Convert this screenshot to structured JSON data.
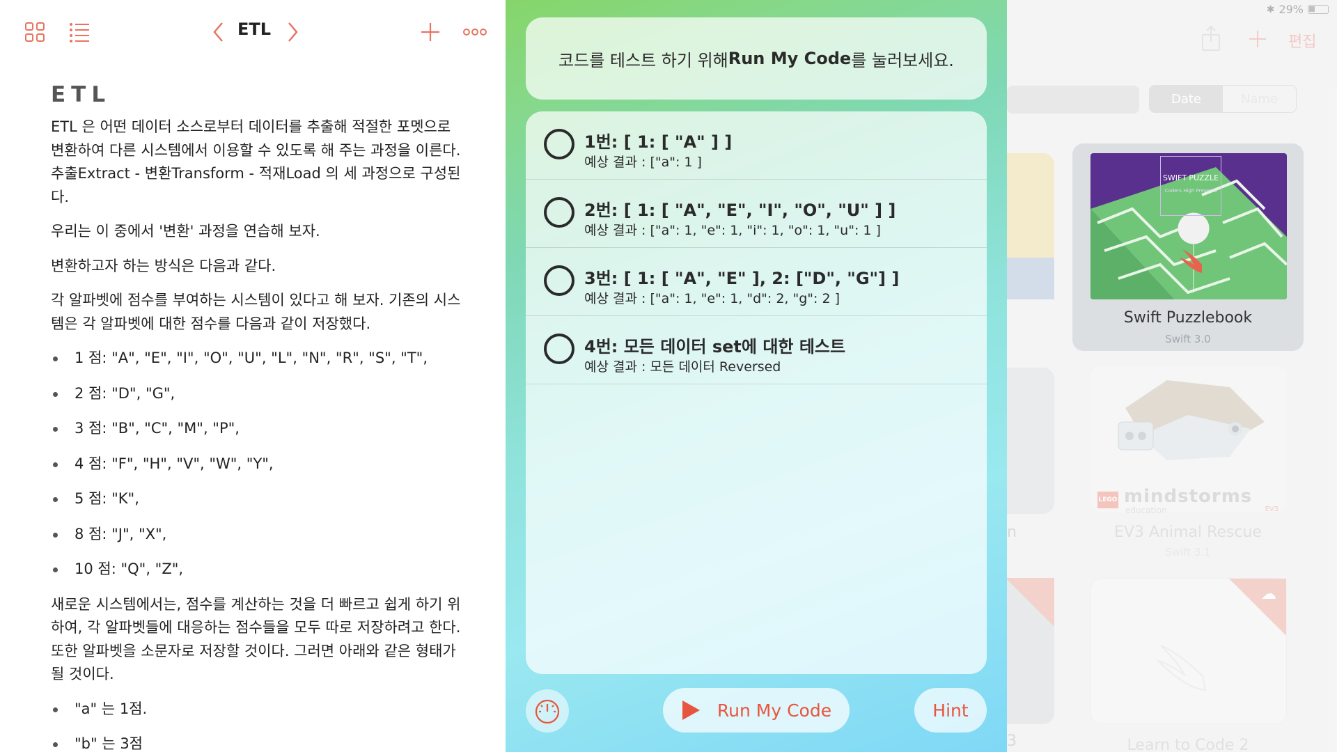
{
  "doc_nav": {
    "title": "ETL"
  },
  "document": {
    "heading": "ETL",
    "paragraphs_top": [
      "ETL 은 어떤 데이터 소스로부터 데이터를 추출해 적절한 포멧으로 변환하여 다른 시스템에서 이용할 수 있도록 해 주는 과정을 이른다. 추출Extract - 변환Transform - 적재Load 의 세 과정으로 구성된다.",
      "우리는 이 중에서 '변환' 과정을 연습해 보자.",
      "변환하고자 하는 방식은 다음과 같다.",
      "각 알파벳에 점수를 부여하는 시스템이 있다고 해 보자. 기존의 시스템은 각 알파벳에 대한 점수를 다음과 같이 저장했다."
    ],
    "score_list": [
      "1 점: \"A\", \"E\", \"I\", \"O\", \"U\", \"L\", \"N\", \"R\", \"S\", \"T\",",
      "2 점: \"D\", \"G\",",
      "3 점: \"B\", \"C\", \"M\", \"P\",",
      "4 점: \"F\", \"H\", \"V\", \"W\", \"Y\",",
      "5 점: \"K\",",
      "8 점: \"J\", \"X\",",
      "10 점: \"Q\", \"Z\","
    ],
    "paragraph_bottom": "새로운 시스템에서는, 점수를 계산하는 것을 더 빠르고 쉽게 하기 위하여, 각 알파벳들에 대응하는 점수들을 모두 따로 저장하려고 한다. 또한 알파벳을 소문자로 저장할 것이다. 그러면 아래와 같은 형태가 될 것이다.",
    "letter_list": [
      "\"a\" 는 1점.",
      "\"b\" 는 3점"
    ]
  },
  "live_view": {
    "banner_prefix": "코드를 테스트 하기 위해 ",
    "banner_bold": "Run My Code",
    "banner_suffix": "를 눌러보세요.",
    "tests": [
      {
        "title": "1번: [ 1: [ \"A\" ] ]",
        "expected": "예상 결과 : [\"a\": 1 ]"
      },
      {
        "title": "2번: [ 1: [ \"A\", \"E\", \"I\", \"O\", \"U\" ] ]",
        "expected": "예상 결과 : [\"a\": 1, \"e\": 1, \"i\": 1, \"o\": 1, \"u\": 1 ]"
      },
      {
        "title": "3번: [ 1: [ \"A\", \"E\" ], 2: [\"D\", \"G\"] ]",
        "expected": "예상 결과 : [\"a\": 1, \"e\": 1, \"d\": 2, \"g\": 2 ]"
      },
      {
        "title": "4번: 모든 데이터 set에 대한 테스트",
        "expected": "예상 결과 : 모든 데이터 Reversed"
      }
    ],
    "run_label": "Run My Code",
    "hint_label": "Hint"
  },
  "library": {
    "battery": "29%",
    "edit_label": "편집",
    "sort_date": "Date",
    "sort_name": "Name",
    "cards": [
      {
        "title": "Swift Puzzlebook",
        "subtitle": "Swift 3.0",
        "cover_title": "SWIFT PUZZLE",
        "cover_sub": "Coders High Presents"
      },
      {
        "title": "EV3 Animal Rescue",
        "subtitle": "Swift 3.1",
        "logo_text": "mindstorms",
        "logo_sub": "education",
        "logo_badge": "EV3",
        "lego": "LEGO"
      },
      {
        "title": "Learn to Code 2"
      }
    ],
    "partial_left_letters": [
      "n",
      "3"
    ]
  },
  "colors": {
    "accent": "#e8553e",
    "icon": "#e8745f"
  }
}
